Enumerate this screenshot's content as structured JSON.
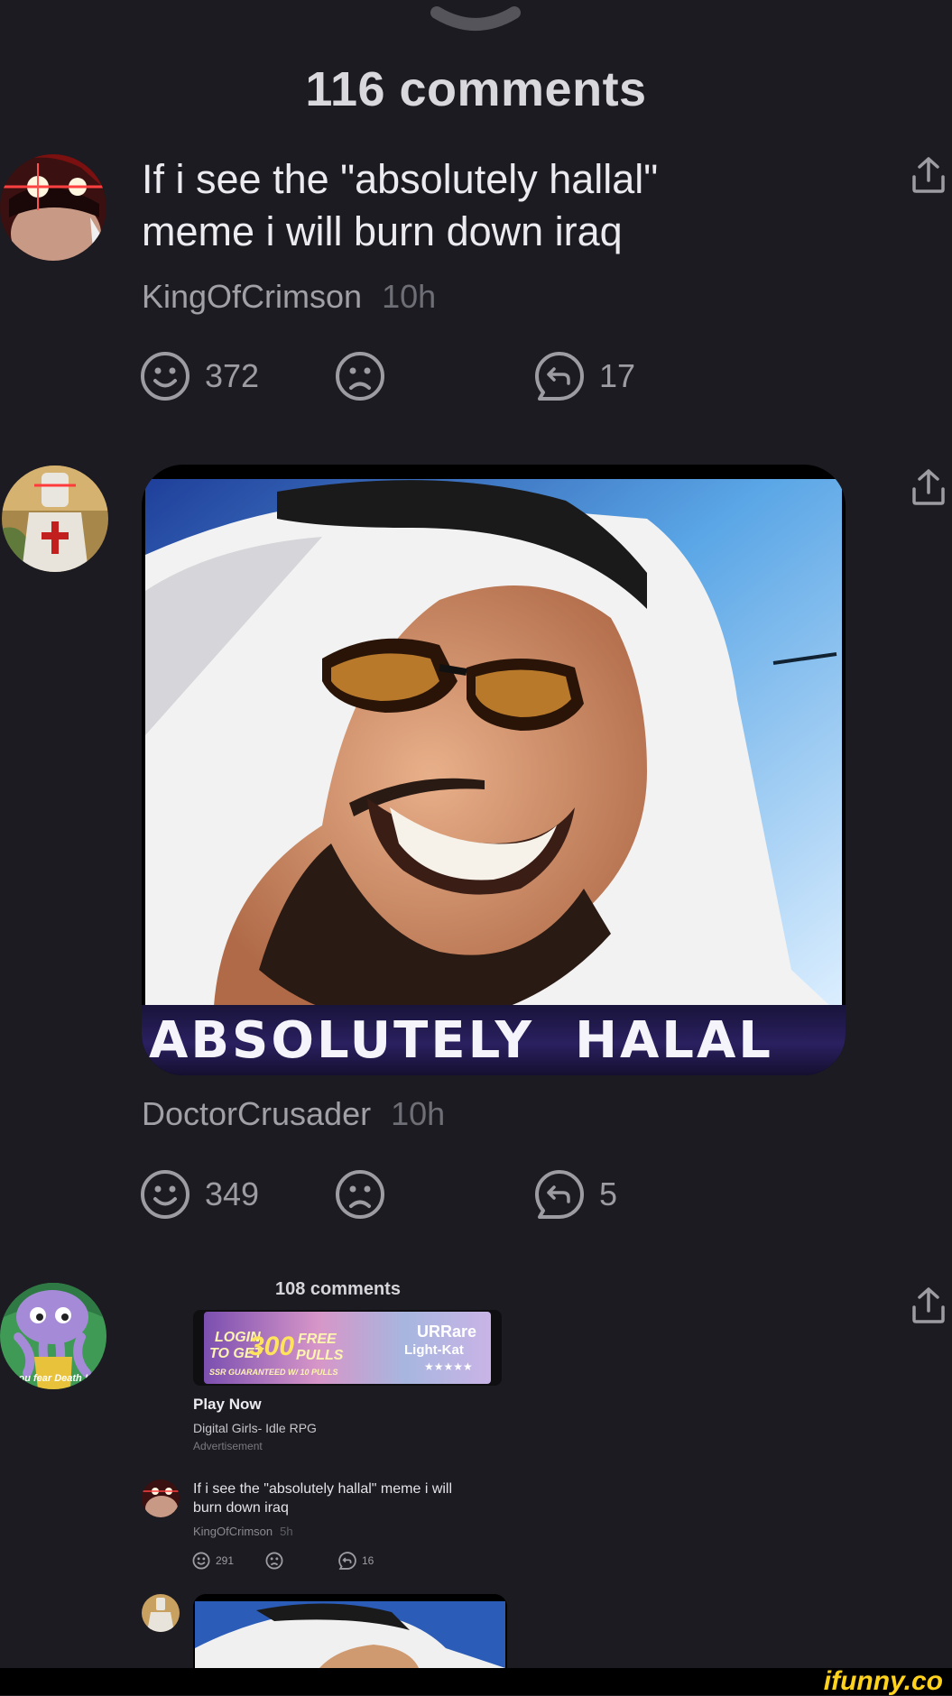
{
  "header": {
    "title": "116 comments"
  },
  "comments": [
    {
      "text_line1": "If i see the \"absolutely hallal\"",
      "text_line2": "meme i will burn down iraq",
      "author": "KingOfCrimson",
      "time": "10h",
      "smiles": "372",
      "replies": "17"
    },
    {
      "image_caption": "ABSOLUTELY  HALAL",
      "author": "DoctorCrusader",
      "time": "10h",
      "smiles": "349",
      "replies": "5"
    },
    {
      "avatar_text": "ou fear Death !",
      "embedded": {
        "title": "108 comments",
        "ad": {
          "login": "LOGIN",
          "to_get": "TO GET",
          "amount": "300",
          "free": "FREE",
          "pulls": "PULLS",
          "guarantee": "SSR GUARANTEED W/ 10 PULLS",
          "ur": "URRare",
          "light": "Light-Kat",
          "stars": "★★★★★",
          "cta": "Play Now",
          "app": "Digital Girls- Idle RPG",
          "label": "Advertisement"
        },
        "comment": {
          "text_line1": "If i see the \"absolutely hallal\" meme i will",
          "text_line2": "burn down iraq",
          "author": "KingOfCrimson",
          "time": "5h",
          "smiles": "291",
          "replies": "16"
        }
      }
    }
  ],
  "footer": {
    "brand": "ifunny.co"
  },
  "icons": [
    "chevron-down-icon",
    "share-icon",
    "smile-icon",
    "frown-icon",
    "reply-icon"
  ],
  "colors": {
    "background": "#1c1b21",
    "brand": "#ffd21e"
  }
}
